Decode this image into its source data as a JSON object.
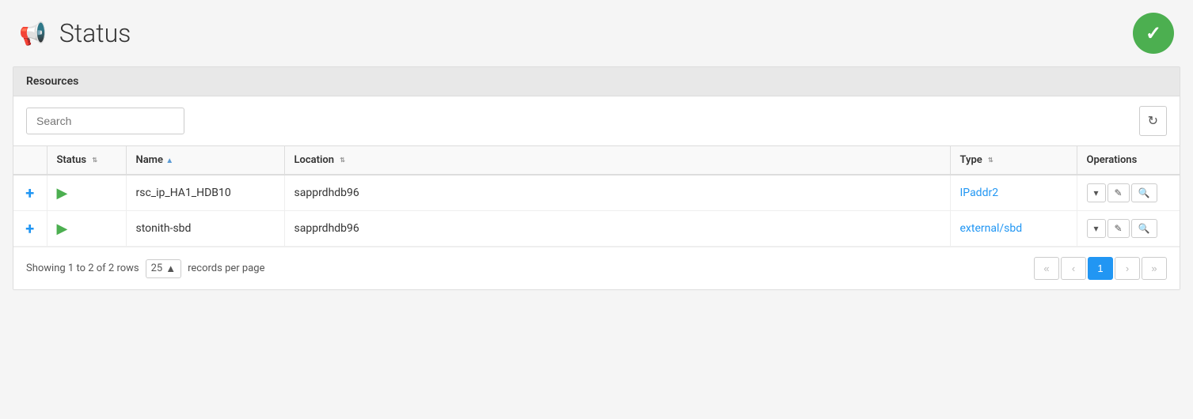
{
  "header": {
    "title": "Status",
    "status_ok": true
  },
  "card": {
    "title": "Resources"
  },
  "toolbar": {
    "search_placeholder": "Search",
    "refresh_label": "↻"
  },
  "table": {
    "columns": [
      {
        "id": "expand",
        "label": ""
      },
      {
        "id": "status",
        "label": "Status",
        "sortable": true,
        "sort": "none"
      },
      {
        "id": "name",
        "label": "Name",
        "sortable": true,
        "sort": "asc"
      },
      {
        "id": "location",
        "label": "Location",
        "sortable": true,
        "sort": "none"
      },
      {
        "id": "type",
        "label": "Type",
        "sortable": true,
        "sort": "none"
      },
      {
        "id": "operations",
        "label": "Operations",
        "sortable": false
      }
    ],
    "rows": [
      {
        "id": "row1",
        "status": "running",
        "name": "rsc_ip_HA1_HDB10",
        "location": "sapprdhdb96",
        "type": "IPaddr2",
        "type_link": true
      },
      {
        "id": "row2",
        "status": "running",
        "name": "stonith-sbd",
        "location": "sapprdhdb96",
        "type": "external/sbd",
        "type_link": true
      }
    ]
  },
  "footer": {
    "showing_text": "Showing 1 to 2 of 2 rows",
    "per_page": "25",
    "per_page_label": "records per page",
    "pagination": {
      "first": "«",
      "prev": "‹",
      "current": "1",
      "next": "›",
      "last": "»"
    }
  },
  "icons": {
    "megaphone": "📢",
    "check": "✓",
    "refresh": "↻",
    "plus": "+",
    "play": "▶",
    "dropdown": "▾",
    "edit": "✎",
    "search": "🔍",
    "sort_asc": "▲",
    "sort_both": "⇅"
  }
}
